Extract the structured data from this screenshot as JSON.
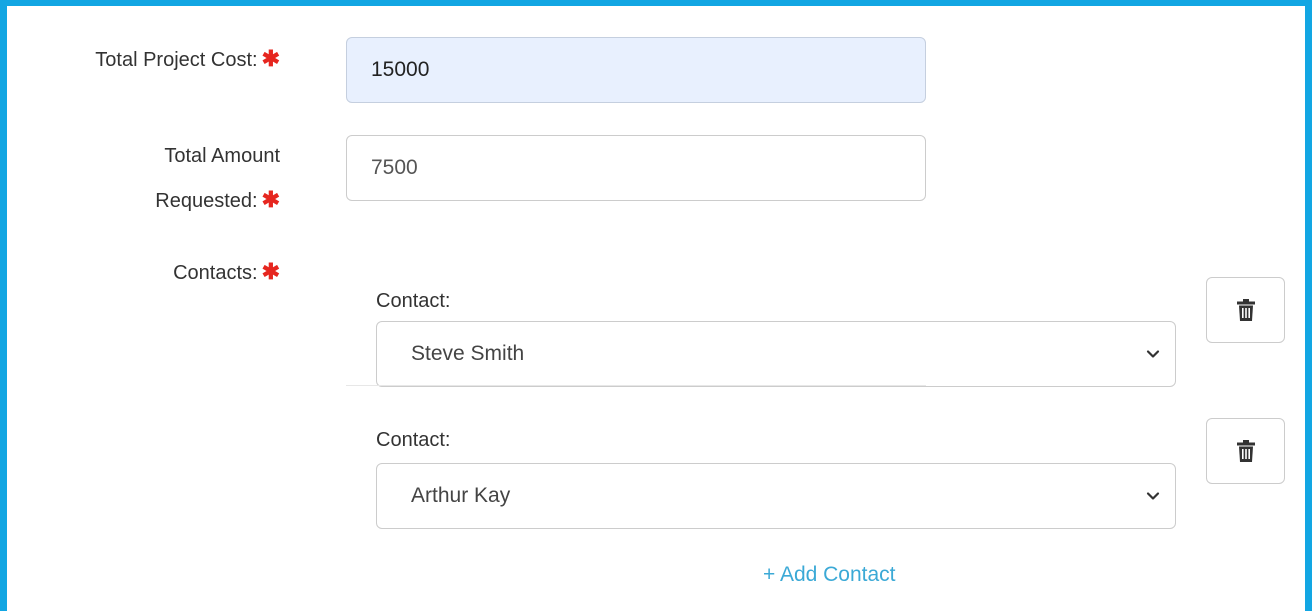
{
  "form": {
    "total_project_cost": {
      "label": "Total Project Cost:",
      "required_mark": "✱",
      "value": "15000"
    },
    "total_amount_requested": {
      "label_line1": "Total Amount",
      "label_line2": "Requested:",
      "required_mark": "✱",
      "value": "7500"
    },
    "contacts": {
      "label": "Contacts:",
      "required_mark": "✱",
      "items": [
        {
          "field_label": "Contact:",
          "selected": "Steve Smith",
          "delete_icon": "trash-icon"
        },
        {
          "field_label": "Contact:",
          "selected": "Arthur Kay",
          "delete_icon": "trash-icon"
        }
      ],
      "add_link": "+ Add Contact"
    }
  },
  "colors": {
    "frame": "#12a6e3",
    "required": "#e6261f",
    "link": "#3ba9d6",
    "focused_bg": "#e8f0fe"
  }
}
